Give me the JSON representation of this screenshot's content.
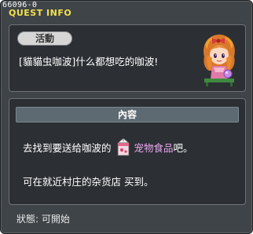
{
  "window": {
    "quest_id": "66096-0",
    "title": "QUEST INFO"
  },
  "summary": {
    "tag_label": "活動",
    "quest_name": "[貓貓虫咖波]什么都想吃的咖波!",
    "npc_icon": "girl-npc-portrait-icon"
  },
  "content": {
    "header": "內容",
    "line1_before": "去找到要送给咖波的",
    "item_icon": "milk-carton-icon",
    "item_name": "宠物食品",
    "line1_after": "吧。",
    "line2": "可在就近村庄的杂货店 买到。"
  },
  "status": {
    "text": "狀態:  可開始"
  },
  "colors": {
    "title": "#f3e04a",
    "item_highlight": "#e8a6ee",
    "background": "#3f4448",
    "panel": "#2c3034"
  }
}
